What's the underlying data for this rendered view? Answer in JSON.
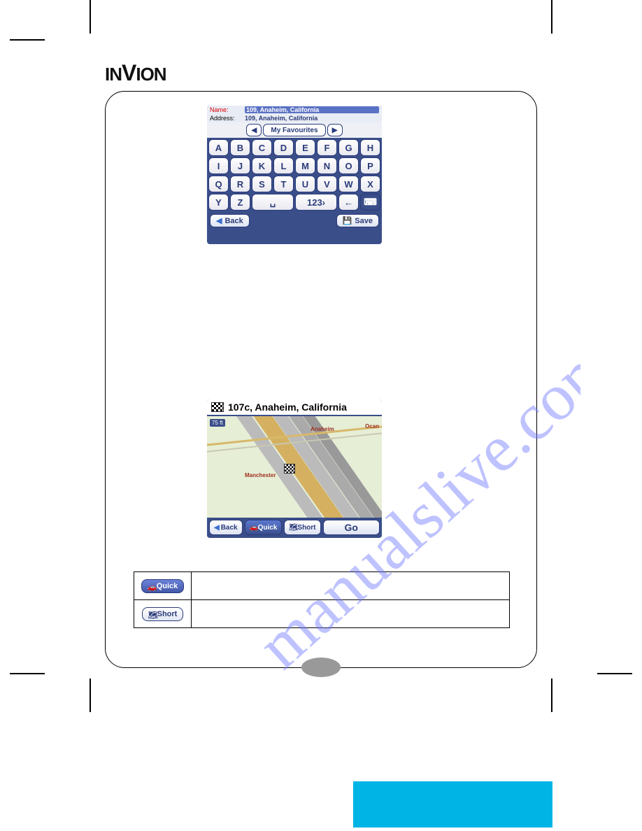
{
  "brand": "INVION",
  "shot1": {
    "name_label": "Name:",
    "name_value": "109, Anaheim, California",
    "address_label": "Address:",
    "address_value": "109, Anaheim, California",
    "fav_button": "My Favourites",
    "keys_row1": [
      "A",
      "B",
      "C",
      "D",
      "E",
      "F",
      "G",
      "H"
    ],
    "keys_row2": [
      "I",
      "J",
      "K",
      "L",
      "M",
      "N",
      "O",
      "P"
    ],
    "keys_row3": [
      "Q",
      "R",
      "S",
      "T",
      "U",
      "V",
      "W",
      "X"
    ],
    "keys_row4": [
      "Y",
      "Z",
      "␣",
      "123›",
      "←",
      "⌨"
    ],
    "back": "Back",
    "save": "Save"
  },
  "shot2": {
    "title": "107c, Anaheim, California",
    "scale": "75 ft",
    "label_anaheim": "Anaheim",
    "label_ocean": "Ocan",
    "label_manchester": "Manchester",
    "back": "Back",
    "quick": "Quick",
    "short": "Short",
    "go": "Go"
  },
  "table": {
    "quick": "Quick",
    "short": "Short"
  },
  "watermark_text": "manualslive.com"
}
